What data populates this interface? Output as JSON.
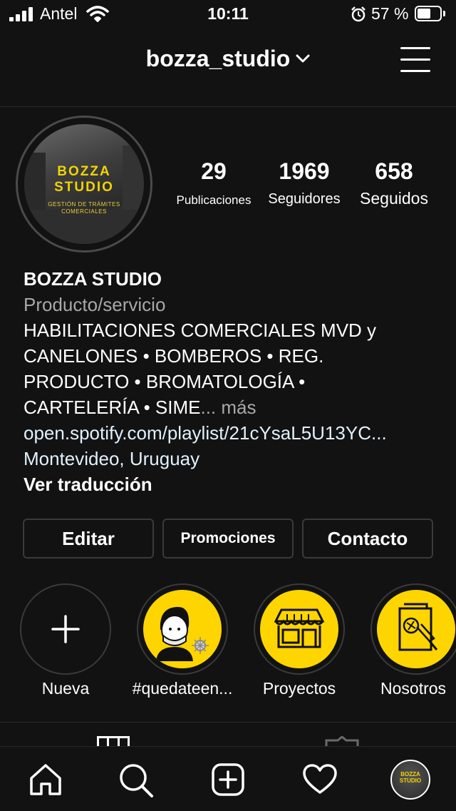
{
  "status_bar": {
    "carrier": "Antel",
    "time": "10:11",
    "battery": "57 %"
  },
  "header": {
    "username": "bozza_studio",
    "dropdown_icon": "chevron-down-icon",
    "menu_icon": "hamburger-menu-icon"
  },
  "profile": {
    "avatar": {
      "title_line1": "BOZZA",
      "title_line2": "STUDIO",
      "subtitle_line1": "GESTIÓN DE TRÁMITES",
      "subtitle_line2": "COMERCIALES"
    },
    "stats": [
      {
        "value": "29",
        "label": "Publicaciones"
      },
      {
        "value": "1969",
        "label": "Seguidores"
      },
      {
        "value": "658",
        "label": "Seguidos"
      }
    ],
    "name": "BOZZA STUDIO",
    "category": "Producto/servicio",
    "bio_lines": [
      "HABILITACIONES COMERCIALES MVD y",
      "CANELONES • BOMBEROS • REG.",
      "PRODUCTO • BROMATOLOGÍA •",
      "CARTELERÍA • SIME"
    ],
    "bio_ellipsis": "...",
    "more_label": "más",
    "link": "open.spotify.com/playlist/21cYsaL5U13YC...",
    "location": "Montevideo, Uruguay",
    "translate_label": "Ver traducción"
  },
  "actions": {
    "edit": "Editar",
    "promotions": "Promociones",
    "contact": "Contacto"
  },
  "highlights": [
    {
      "label": "Nueva",
      "icon": "plus-icon"
    },
    {
      "label": "#quedateen...",
      "icon": "masked-person-icon"
    },
    {
      "label": "Proyectos",
      "icon": "storefront-icon"
    },
    {
      "label": "Nosotros",
      "icon": "drawing-board-icon"
    }
  ],
  "tabs": {
    "grid_icon": "grid-icon",
    "tagged_icon": "tagged-icon"
  },
  "bottom_nav": [
    "home-icon",
    "search-icon",
    "new-post-icon",
    "activity-heart-icon",
    "profile-avatar-icon"
  ],
  "colors": {
    "background": "#121212",
    "accent_yellow": "#ffd500",
    "link_blue": "#e0f1ff",
    "muted": "#a8a8a8"
  }
}
